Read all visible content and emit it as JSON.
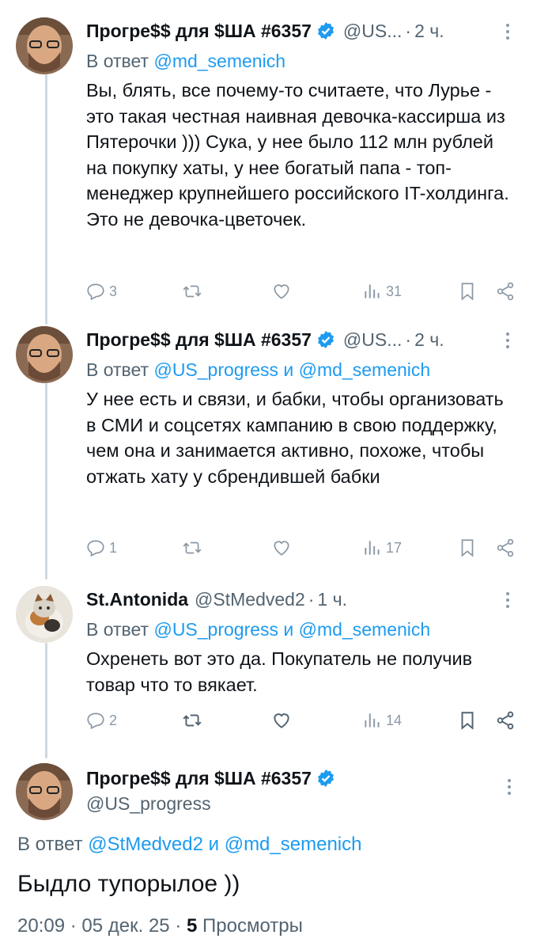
{
  "tweets": [
    {
      "name": "Прогре$$ для $ША #6357",
      "handle": "@US...",
      "time": "2 ч.",
      "reply_prefix": "В ответ",
      "reply_to": "@md_semenich",
      "text": "Вы, блять, все почему-то считаете, что Лурье - это такая честная наивная девочка-кассирша из Пятерочки ))) Сука, у нее было 112 млн рублей на покупку хаты, у нее богатый папа - топ-менеджер крупнейшего российского IT-холдинга. Это не девочка-цветочек.",
      "replies": "3",
      "views": "31"
    },
    {
      "name": "Прогре$$ для $ША #6357",
      "handle": "@US...",
      "time": "2 ч.",
      "reply_prefix": "В ответ",
      "reply_to": "@US_progress и @md_semenich",
      "text": "У нее есть и связи, и бабки, чтобы организовать в СМИ и соцсетях кампанию в свою поддержку, чем она и занимается активно, похоже, чтобы отжать хату у сбрендившей бабки",
      "replies": "1",
      "views": "17"
    },
    {
      "name": "St.Antonida",
      "handle": "@StMedved2",
      "time": "1 ч.",
      "reply_prefix": "В ответ",
      "reply_to": "@US_progress и @md_semenich",
      "text": "Охренеть вот это да. Покупатель не получив товар что то вякает.",
      "replies": "2",
      "views": "14"
    }
  ],
  "main_tweet": {
    "name": "Прогре$$ для $ША #6357",
    "handle": "@US_progress",
    "reply_prefix": "В ответ",
    "reply_to": "@StMedved2 и @md_semenich",
    "text": "Быдло тупорылое ))",
    "time": "20:09",
    "date": "05 дек. 25",
    "views_count": "5",
    "views_label": "Просмотры"
  },
  "colors": {
    "accent": "#1d9bf0",
    "muted": "#536471",
    "icon": "#8b98a5",
    "line": "#cfd9de"
  }
}
